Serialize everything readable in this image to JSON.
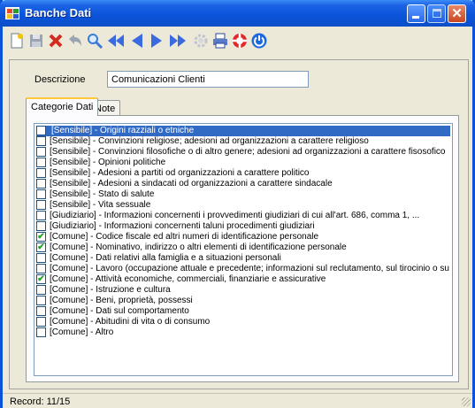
{
  "window": {
    "title": "Banche Dati",
    "colors": {
      "titlebar": "#0a53d9",
      "selection": "#316ac5",
      "check": "#21a121"
    }
  },
  "toolbar": {
    "buttons": [
      {
        "name": "new-icon"
      },
      {
        "name": "save-icon"
      },
      {
        "name": "delete-icon"
      },
      {
        "name": "undo-icon"
      },
      {
        "name": "search-icon"
      },
      {
        "name": "first-record-icon"
      },
      {
        "name": "previous-record-icon"
      },
      {
        "name": "next-record-icon"
      },
      {
        "name": "last-record-icon"
      },
      {
        "name": "settings-icon"
      },
      {
        "name": "print-icon"
      },
      {
        "name": "help-icon"
      },
      {
        "name": "power-icon"
      }
    ]
  },
  "form": {
    "description_label": "Descrizione",
    "description_value": "Comunicazioni Clienti"
  },
  "tabs": [
    {
      "label": "Categorie Dati",
      "active": true
    },
    {
      "label": "Note",
      "active": false
    }
  ],
  "list": {
    "items": [
      {
        "text": "[Sensibile] - Origini razziali o etniche",
        "checked": false,
        "selected": true
      },
      {
        "text": "[Sensibile] - Convinzioni religiose; adesioni ad organizzazioni a carattere religioso",
        "checked": false,
        "selected": false
      },
      {
        "text": "[Sensibile] - Convinzioni filosofiche o di altro genere; adesioni ad organizzazioni a carattere fisosofico",
        "checked": false,
        "selected": false
      },
      {
        "text": "[Sensibile] - Opinioni politiche",
        "checked": false,
        "selected": false
      },
      {
        "text": "[Sensibile] - Adesioni a partiti od organizzazioni a carattere politico",
        "checked": false,
        "selected": false
      },
      {
        "text": "[Sensibile] - Adesioni a sindacati od organizzazioni a carattere sindacale",
        "checked": false,
        "selected": false
      },
      {
        "text": "[Sensibile] - Stato di salute",
        "checked": false,
        "selected": false
      },
      {
        "text": "[Sensibile] - Vita sessuale",
        "checked": false,
        "selected": false
      },
      {
        "text": "[Giudiziario] - Informazioni concernenti i provvedimenti giudiziari di cui all'art. 686, comma 1, ...",
        "checked": false,
        "selected": false
      },
      {
        "text": "[Giudiziario] - Informazioni concernenti taluni procedimenti giudiziari",
        "checked": false,
        "selected": false
      },
      {
        "text": "[Comune] - Codice fiscale ed altri numeri di identificazione personale",
        "checked": true,
        "selected": false
      },
      {
        "text": "[Comune] - Nominativo, indirizzo o altri elementi di identificazione personale",
        "checked": true,
        "selected": false
      },
      {
        "text": "[Comune] - Dati relativi alla famiglia e a situazioni personali",
        "checked": false,
        "selected": false
      },
      {
        "text": "[Comune] - Lavoro (occupazione attuale e precedente; informazioni sul reclutamento, sul tirocinio o su",
        "checked": false,
        "selected": false
      },
      {
        "text": "[Comune] - Attività economiche, commerciali, finanziarie e assicurative",
        "checked": true,
        "selected": false
      },
      {
        "text": "[Comune] - Istruzione e cultura",
        "checked": false,
        "selected": false
      },
      {
        "text": "[Comune] - Beni, proprietà, possessi",
        "checked": false,
        "selected": false
      },
      {
        "text": "[Comune] - Dati sul comportamento",
        "checked": false,
        "selected": false
      },
      {
        "text": "[Comune] - Abitudini di vita o di consumo",
        "checked": false,
        "selected": false
      },
      {
        "text": "[Comune] - Altro",
        "checked": false,
        "selected": false
      }
    ]
  },
  "status": {
    "text": "Record: 11/15"
  }
}
